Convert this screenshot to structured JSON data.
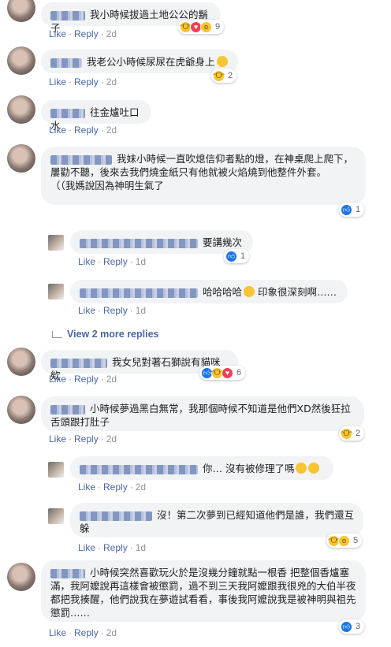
{
  "comments": [
    {
      "text": "我小時候拔過土地公公的鬍子",
      "like": "Like",
      "reply": "Reply",
      "time": "2d",
      "react_count": "9"
    },
    {
      "text": "我老公小時候尿尿在虎爺身上",
      "like": "Like",
      "reply": "Reply",
      "time": "2d",
      "react_count": "2"
    },
    {
      "text": "往金爐吐口水",
      "like": "Like",
      "reply": "Reply",
      "time": "2d"
    },
    {
      "text": "我妹小時候一直吹熄信仰者點的燈，在神桌爬上爬下，屢勸不聽，後來去我們燒金紙只有他就被火焰燒到他整件外套。\n（（我媽說因為神明生氣了",
      "react_count": "1"
    },
    {
      "text": "要講幾次",
      "like": "Like",
      "reply": "Reply",
      "time": "1d",
      "react_count": "1"
    },
    {
      "text": "哈哈哈哈",
      "text2": "印象很深刻啊……",
      "like": "Like",
      "reply": "Reply",
      "time": "1d"
    },
    {
      "view_more": "View 2 more replies"
    },
    {
      "text": "我女兒對著石獅說有貓咪欸",
      "like": "Like",
      "reply": "Reply",
      "time": "2d",
      "react_count": "6"
    },
    {
      "text": "小時候夢過黑白無常，我那個時候不知道是他們XD然後狂拉舌頭跟打肚子",
      "like": "Like",
      "reply": "Reply",
      "time": "2d",
      "react_count": "2"
    },
    {
      "text": "你… 沒有被修理了嗎",
      "like": "Like",
      "reply": "Reply",
      "time": "2d"
    },
    {
      "text": "沒！第二次夢到已經知道他們是誰，我們還互躲",
      "like": "Like",
      "reply": "Reply",
      "time": "1d",
      "react_count": "5"
    },
    {
      "text": "小時候突然喜歡玩火於是沒幾分鐘就點一根香 把整個香爐塞滿，我阿嬤說再這樣會被懲罰，過不到三天我阿嬤跟我很兇的大伯半夜都把我揍醒，他們說我在夢遊試看看，事後我阿嬤說我是被神明與祖先懲罰……",
      "like": "Like",
      "reply": "Reply",
      "time": "2d",
      "react_count": "3"
    }
  ]
}
